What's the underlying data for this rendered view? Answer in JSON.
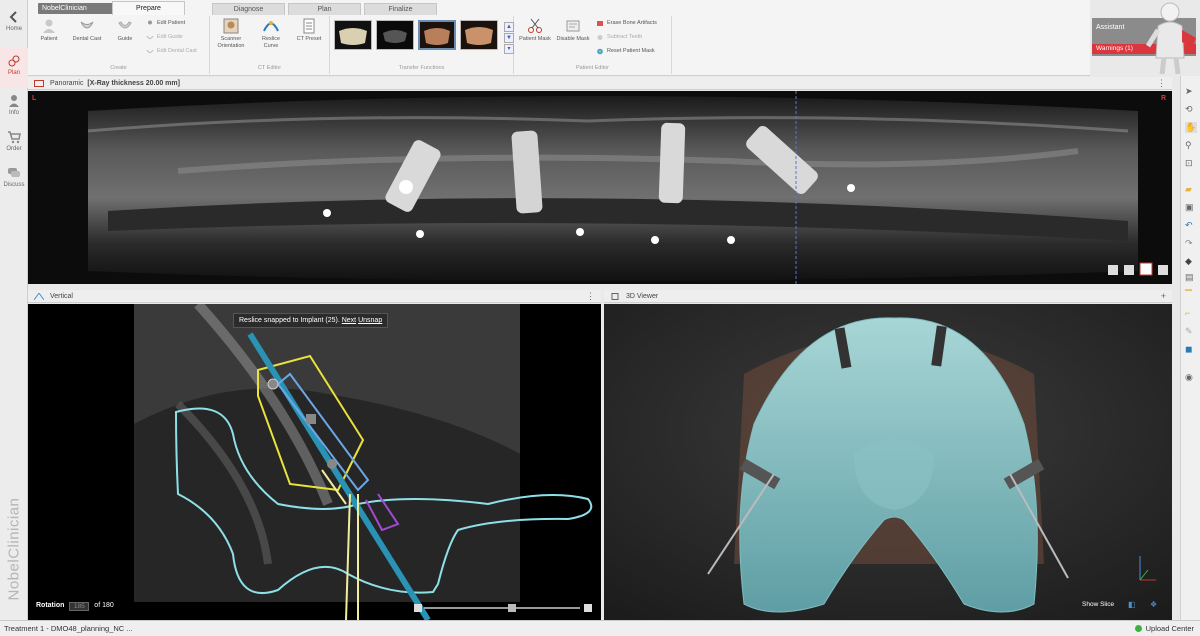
{
  "nav": {
    "items": [
      {
        "label": "Home",
        "icon": "back-arrow-icon"
      },
      {
        "label": "Plan",
        "icon": "plan-icon",
        "active": true
      },
      {
        "label": "Info",
        "icon": "person-icon"
      },
      {
        "label": "Order",
        "icon": "cart-icon"
      },
      {
        "label": "Discuss",
        "icon": "chat-icon"
      }
    ],
    "brand": "NobelClinician"
  },
  "app_selector": "NobelClinician",
  "tabs": [
    "Prepare",
    "Diagnose",
    "Plan",
    "Finalize"
  ],
  "active_tab": "Prepare",
  "ribbon": {
    "create": {
      "title": "Create",
      "patient": "Patient",
      "dental_cast": "Dental Cast",
      "guide": "Guide",
      "edit_patient": "Edit Patient",
      "edit_guide": "Edit Guide",
      "edit_dental_cast": "Edit Dental Cast"
    },
    "ct_editor": {
      "title": "CT Editor",
      "scanner_orientation": "Scanner Orientation",
      "reslice_curve": "Reslice Curve",
      "ct_preset": "CT Preset"
    },
    "transfer": {
      "title": "Transfer Functions"
    },
    "patient_editor": {
      "title": "Patient Editor",
      "patient_mask": "Patient Mask",
      "disable_mask": "Disable Mask",
      "erase_bone": "Erase Bone Artifacts",
      "subtract_teeth": "Subtract Teeth",
      "reset_mask": "Reset Patient Mask"
    }
  },
  "assistant": {
    "title": "Assistant",
    "warnings": "Warnings (1)"
  },
  "panoramic": {
    "label": "Panoramic",
    "thickness": "[X-Ray thickness 20.00 mm]",
    "marker_left": "L",
    "marker_right": "R"
  },
  "vertical": {
    "label": "Vertical",
    "tooltip_text": "Reslice snapped to Implant (25).",
    "tooltip_next": "Next",
    "tooltip_unsnap": "Unsnap",
    "rotation_label": "Rotation",
    "rotation_value": "185",
    "rotation_total": "of 180"
  },
  "viewer3d": {
    "label": "3D Viewer",
    "show_slice": "Show Slice"
  },
  "status": {
    "left": "Treatment 1 - DMO48_planning_NC ...",
    "right": "Upload Center"
  },
  "colors": {
    "accent": "#d9363e",
    "implant_line": "#2a93b5",
    "bone_outline": "#8ee0e8",
    "guide_yellow": "#e8e23a"
  }
}
